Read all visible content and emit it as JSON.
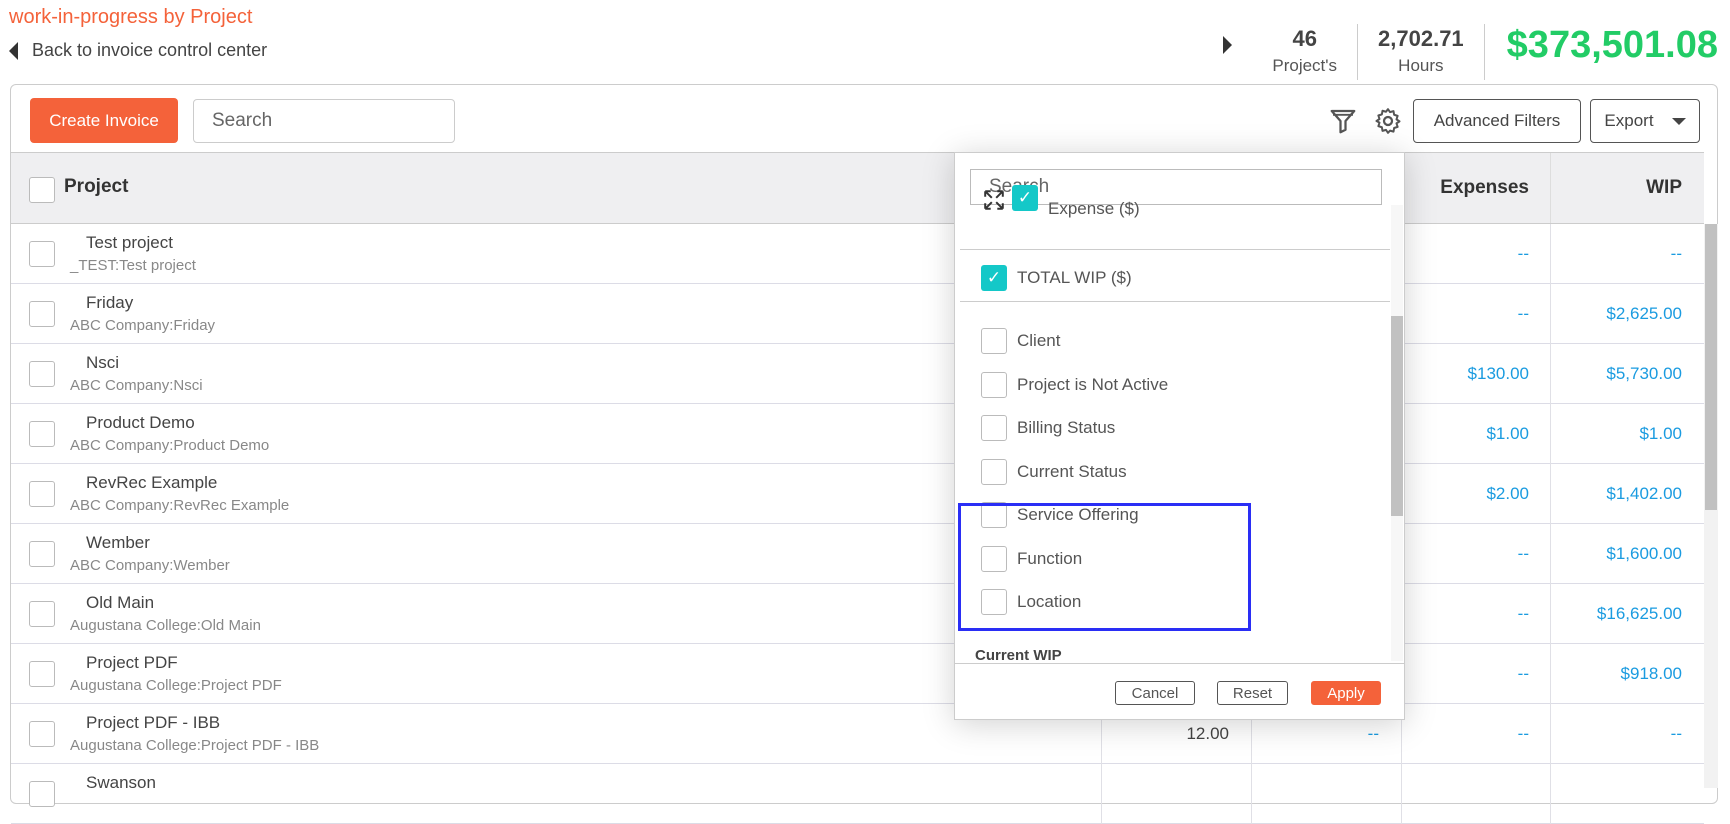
{
  "header": {
    "title": "work-in-progress by Project",
    "back_label": "Back to invoice control center"
  },
  "stats": {
    "projects": "46",
    "projects_label": "Project's",
    "hours": "2,702.71",
    "hours_label": "Hours",
    "total": "$373,501.08",
    "total_color": "#22cc66"
  },
  "toolbar": {
    "create_label": "Create Invoice",
    "search_placeholder": "Search",
    "advanced_filters_label": "Advanced Filters",
    "export_label": "Export"
  },
  "table": {
    "headers": {
      "project": "Project",
      "expenses": "Expenses",
      "wip": "WIP"
    },
    "rows": [
      {
        "name": "Test project",
        "sub": "_TEST:Test project",
        "c1": "",
        "c2": "",
        "expenses": "--",
        "wip": "--"
      },
      {
        "name": "Friday",
        "sub": "ABC Company:Friday",
        "c1": "",
        "c2": "",
        "expenses": "--",
        "wip": "$2,625.00"
      },
      {
        "name": "Nsci",
        "sub": "ABC Company:Nsci",
        "c1": "",
        "c2": "",
        "expenses": "$130.00",
        "wip": "$5,730.00"
      },
      {
        "name": "Product Demo",
        "sub": "ABC Company:Product Demo",
        "c1": "",
        "c2": "",
        "expenses": "$1.00",
        "wip": "$1.00"
      },
      {
        "name": "RevRec Example",
        "sub": "ABC Company:RevRec Example",
        "c1": "",
        "c2": "",
        "expenses": "$2.00",
        "wip": "$1,402.00"
      },
      {
        "name": "Wember",
        "sub": "ABC Company:Wember",
        "c1": "",
        "c2": "",
        "expenses": "--",
        "wip": "$1,600.00"
      },
      {
        "name": "Old Main",
        "sub": "Augustana College:Old Main",
        "c1": "",
        "c2": "",
        "expenses": "--",
        "wip": "$16,625.00"
      },
      {
        "name": "Project PDF",
        "sub": "Augustana College:Project PDF",
        "c1": "",
        "c2": "",
        "expenses": "--",
        "wip": "$918.00"
      },
      {
        "name": "Project PDF - IBB",
        "sub": "Augustana College:Project PDF - IBB",
        "c1": "12.00",
        "c2": "--",
        "expenses": "--",
        "wip": "--"
      },
      {
        "name": "Swanson",
        "sub": "",
        "c1": "",
        "c2": "",
        "expenses": "",
        "wip": ""
      }
    ]
  },
  "popup": {
    "search_placeholder": "Search",
    "checked": [
      {
        "label": "Expense ($)",
        "checked": true
      },
      {
        "label": "TOTAL WIP ($)",
        "checked": true
      }
    ],
    "options": [
      {
        "label": "Client"
      },
      {
        "label": "Project is Not Active"
      },
      {
        "label": "Billing Status"
      },
      {
        "label": "Current Status"
      },
      {
        "label": "Service Offering"
      },
      {
        "label": "Function"
      },
      {
        "label": "Location"
      }
    ],
    "section_label": "Current WIP",
    "cancel_label": "Cancel",
    "reset_label": "Reset",
    "apply_label": "Apply"
  },
  "colors": {
    "accent": "#f4623a",
    "link": "#1a9be0",
    "check": "#14c8c8",
    "highlight": "#2a2ef5"
  }
}
